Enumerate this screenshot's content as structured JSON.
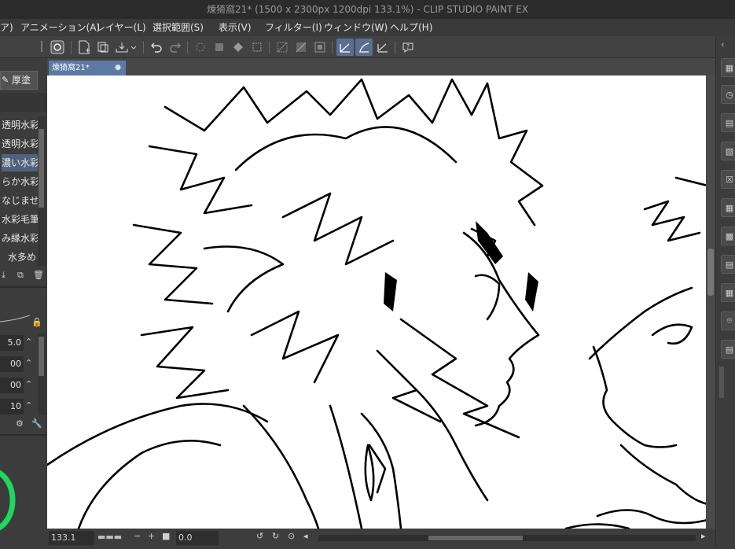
{
  "window": {
    "title": "煉猗窩21* (1500 x 2300px 1200dpi 133.1%) - CLIP STUDIO PAINT EX"
  },
  "menu": {
    "items": [
      "ア)",
      "アニメーション(A)",
      "レイヤー(L)",
      "選択範囲(S)",
      "表示(V)",
      "フィルター(I)",
      "ウィンドウ(W)",
      "ヘルプ(H)"
    ]
  },
  "toolbar": {
    "icons": [
      "clip-logo-icon",
      "new-file-icon",
      "save-icon",
      "undo-icon",
      "redo-icon",
      "clear-icon",
      "fill-icon",
      "transform-icon",
      "deselect-icon",
      "invert-selection-icon",
      "show-selection-icon",
      "snap-ruler-icon",
      "snap-special-ruler-icon",
      "snap-grid-icon",
      "help-icon"
    ]
  },
  "document_tab": {
    "label": "煉猗窩21*",
    "modified_marker": "●"
  },
  "left_panel": {
    "tool_tab_label": "厚塗り",
    "brushes": [
      "透明水彩",
      "透明水彩",
      "濃い水彩",
      "らか水彩",
      "なじませ",
      "水彩毛筆",
      "み縁水彩",
      "水多め"
    ],
    "selected_brush_index": 2,
    "property_values": [
      "5.0",
      "00",
      "00",
      "10"
    ]
  },
  "status_bar": {
    "zoom": "133.1",
    "rotation": "0.0"
  },
  "colors": {
    "title_bg": "#2b2b2b",
    "menu_bg": "#3a3a3a",
    "panel_bg": "#3c3c3c",
    "tab_active": "#5d7aa6",
    "selected_row": "#50627d",
    "canvas": "#ffffff",
    "color_wheel_green": "#1ed760"
  }
}
